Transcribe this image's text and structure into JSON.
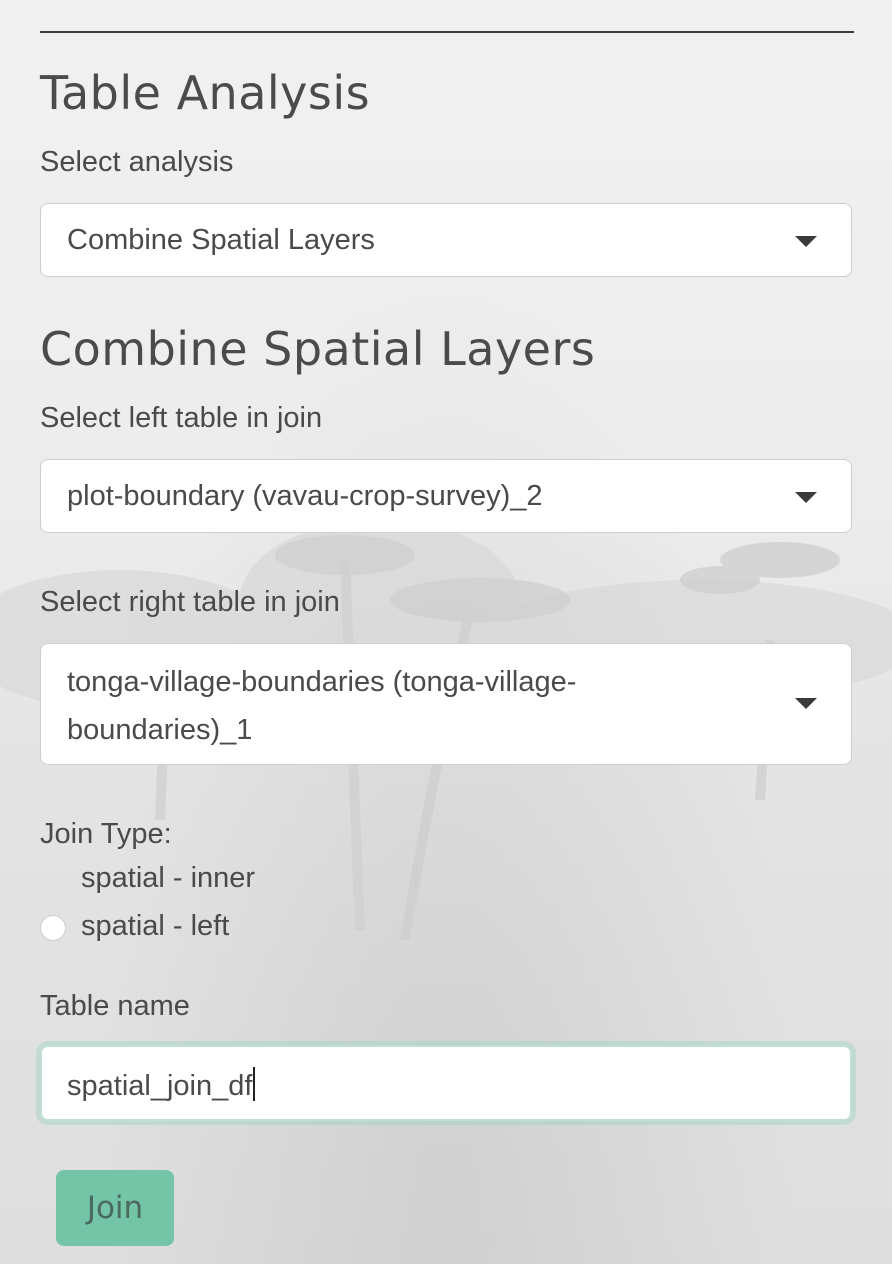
{
  "section_title": "Table Analysis",
  "analysis_select": {
    "label": "Select analysis",
    "value": "Combine Spatial Layers"
  },
  "subsection_title": "Combine Spatial Layers",
  "left_table_select": {
    "label": "Select left table in join",
    "value": "plot-boundary (vavau-crop-survey)_2"
  },
  "right_table_select": {
    "label": "Select right table in join",
    "value_line1": "tonga-village-boundaries (tonga-village-",
    "value_line2": "boundaries)_1"
  },
  "join_type": {
    "label": "Join Type:",
    "options": [
      {
        "label": "spatial - inner",
        "selected": true
      },
      {
        "label": "spatial - left",
        "selected": false
      }
    ]
  },
  "table_name": {
    "label": "Table name",
    "value": "spatial_join_df"
  },
  "join_button_label": "Join",
  "colors": {
    "accent": "#74c4a8",
    "focus_ring": "#bfe0d3",
    "text": "#4a4a4a"
  }
}
